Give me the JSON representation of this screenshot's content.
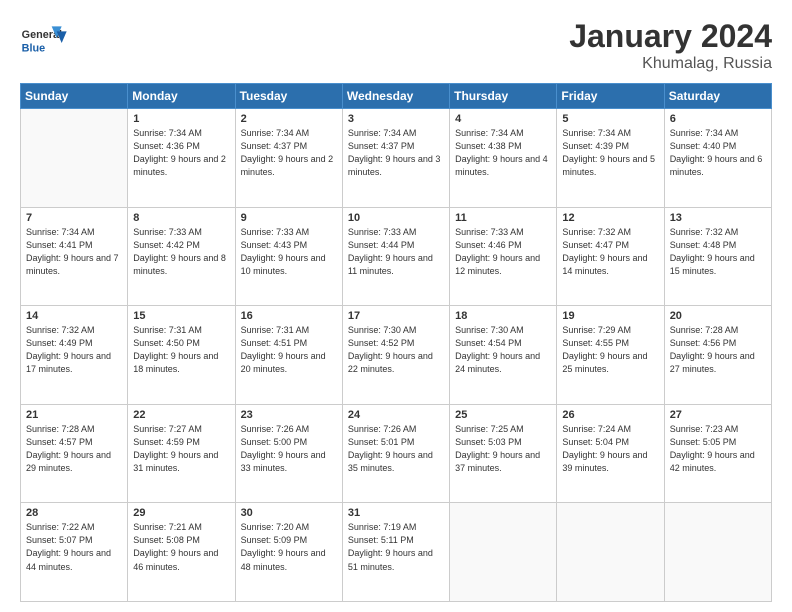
{
  "logo": {
    "line1": "General",
    "line2": "Blue"
  },
  "title": "January 2024",
  "subtitle": "Khumalag, Russia",
  "weekdays": [
    "Sunday",
    "Monday",
    "Tuesday",
    "Wednesday",
    "Thursday",
    "Friday",
    "Saturday"
  ],
  "weeks": [
    [
      {
        "day": "",
        "sunrise": "",
        "sunset": "",
        "daylight": ""
      },
      {
        "day": "1",
        "sunrise": "Sunrise: 7:34 AM",
        "sunset": "Sunset: 4:36 PM",
        "daylight": "Daylight: 9 hours and 2 minutes."
      },
      {
        "day": "2",
        "sunrise": "Sunrise: 7:34 AM",
        "sunset": "Sunset: 4:37 PM",
        "daylight": "Daylight: 9 hours and 2 minutes."
      },
      {
        "day": "3",
        "sunrise": "Sunrise: 7:34 AM",
        "sunset": "Sunset: 4:37 PM",
        "daylight": "Daylight: 9 hours and 3 minutes."
      },
      {
        "day": "4",
        "sunrise": "Sunrise: 7:34 AM",
        "sunset": "Sunset: 4:38 PM",
        "daylight": "Daylight: 9 hours and 4 minutes."
      },
      {
        "day": "5",
        "sunrise": "Sunrise: 7:34 AM",
        "sunset": "Sunset: 4:39 PM",
        "daylight": "Daylight: 9 hours and 5 minutes."
      },
      {
        "day": "6",
        "sunrise": "Sunrise: 7:34 AM",
        "sunset": "Sunset: 4:40 PM",
        "daylight": "Daylight: 9 hours and 6 minutes."
      }
    ],
    [
      {
        "day": "7",
        "sunrise": "Sunrise: 7:34 AM",
        "sunset": "Sunset: 4:41 PM",
        "daylight": "Daylight: 9 hours and 7 minutes."
      },
      {
        "day": "8",
        "sunrise": "Sunrise: 7:33 AM",
        "sunset": "Sunset: 4:42 PM",
        "daylight": "Daylight: 9 hours and 8 minutes."
      },
      {
        "day": "9",
        "sunrise": "Sunrise: 7:33 AM",
        "sunset": "Sunset: 4:43 PM",
        "daylight": "Daylight: 9 hours and 10 minutes."
      },
      {
        "day": "10",
        "sunrise": "Sunrise: 7:33 AM",
        "sunset": "Sunset: 4:44 PM",
        "daylight": "Daylight: 9 hours and 11 minutes."
      },
      {
        "day": "11",
        "sunrise": "Sunrise: 7:33 AM",
        "sunset": "Sunset: 4:46 PM",
        "daylight": "Daylight: 9 hours and 12 minutes."
      },
      {
        "day": "12",
        "sunrise": "Sunrise: 7:32 AM",
        "sunset": "Sunset: 4:47 PM",
        "daylight": "Daylight: 9 hours and 14 minutes."
      },
      {
        "day": "13",
        "sunrise": "Sunrise: 7:32 AM",
        "sunset": "Sunset: 4:48 PM",
        "daylight": "Daylight: 9 hours and 15 minutes."
      }
    ],
    [
      {
        "day": "14",
        "sunrise": "Sunrise: 7:32 AM",
        "sunset": "Sunset: 4:49 PM",
        "daylight": "Daylight: 9 hours and 17 minutes."
      },
      {
        "day": "15",
        "sunrise": "Sunrise: 7:31 AM",
        "sunset": "Sunset: 4:50 PM",
        "daylight": "Daylight: 9 hours and 18 minutes."
      },
      {
        "day": "16",
        "sunrise": "Sunrise: 7:31 AM",
        "sunset": "Sunset: 4:51 PM",
        "daylight": "Daylight: 9 hours and 20 minutes."
      },
      {
        "day": "17",
        "sunrise": "Sunrise: 7:30 AM",
        "sunset": "Sunset: 4:52 PM",
        "daylight": "Daylight: 9 hours and 22 minutes."
      },
      {
        "day": "18",
        "sunrise": "Sunrise: 7:30 AM",
        "sunset": "Sunset: 4:54 PM",
        "daylight": "Daylight: 9 hours and 24 minutes."
      },
      {
        "day": "19",
        "sunrise": "Sunrise: 7:29 AM",
        "sunset": "Sunset: 4:55 PM",
        "daylight": "Daylight: 9 hours and 25 minutes."
      },
      {
        "day": "20",
        "sunrise": "Sunrise: 7:28 AM",
        "sunset": "Sunset: 4:56 PM",
        "daylight": "Daylight: 9 hours and 27 minutes."
      }
    ],
    [
      {
        "day": "21",
        "sunrise": "Sunrise: 7:28 AM",
        "sunset": "Sunset: 4:57 PM",
        "daylight": "Daylight: 9 hours and 29 minutes."
      },
      {
        "day": "22",
        "sunrise": "Sunrise: 7:27 AM",
        "sunset": "Sunset: 4:59 PM",
        "daylight": "Daylight: 9 hours and 31 minutes."
      },
      {
        "day": "23",
        "sunrise": "Sunrise: 7:26 AM",
        "sunset": "Sunset: 5:00 PM",
        "daylight": "Daylight: 9 hours and 33 minutes."
      },
      {
        "day": "24",
        "sunrise": "Sunrise: 7:26 AM",
        "sunset": "Sunset: 5:01 PM",
        "daylight": "Daylight: 9 hours and 35 minutes."
      },
      {
        "day": "25",
        "sunrise": "Sunrise: 7:25 AM",
        "sunset": "Sunset: 5:03 PM",
        "daylight": "Daylight: 9 hours and 37 minutes."
      },
      {
        "day": "26",
        "sunrise": "Sunrise: 7:24 AM",
        "sunset": "Sunset: 5:04 PM",
        "daylight": "Daylight: 9 hours and 39 minutes."
      },
      {
        "day": "27",
        "sunrise": "Sunrise: 7:23 AM",
        "sunset": "Sunset: 5:05 PM",
        "daylight": "Daylight: 9 hours and 42 minutes."
      }
    ],
    [
      {
        "day": "28",
        "sunrise": "Sunrise: 7:22 AM",
        "sunset": "Sunset: 5:07 PM",
        "daylight": "Daylight: 9 hours and 44 minutes."
      },
      {
        "day": "29",
        "sunrise": "Sunrise: 7:21 AM",
        "sunset": "Sunset: 5:08 PM",
        "daylight": "Daylight: 9 hours and 46 minutes."
      },
      {
        "day": "30",
        "sunrise": "Sunrise: 7:20 AM",
        "sunset": "Sunset: 5:09 PM",
        "daylight": "Daylight: 9 hours and 48 minutes."
      },
      {
        "day": "31",
        "sunrise": "Sunrise: 7:19 AM",
        "sunset": "Sunset: 5:11 PM",
        "daylight": "Daylight: 9 hours and 51 minutes."
      },
      {
        "day": "",
        "sunrise": "",
        "sunset": "",
        "daylight": ""
      },
      {
        "day": "",
        "sunrise": "",
        "sunset": "",
        "daylight": ""
      },
      {
        "day": "",
        "sunrise": "",
        "sunset": "",
        "daylight": ""
      }
    ]
  ]
}
